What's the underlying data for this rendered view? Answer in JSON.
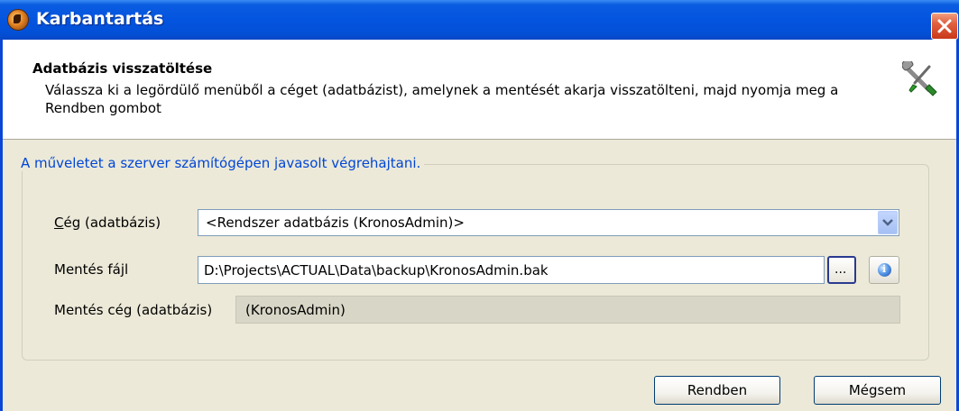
{
  "window": {
    "title": "Karbantartás"
  },
  "header": {
    "title": "Adatbázis visszatöltése",
    "description": "Válassza ki a legördülő menüből a céget (adatbázist), amelynek a mentését akarja visszatölteni, majd nyomja meg a Rendben gombot"
  },
  "group": {
    "caption": "A műveletet a szerver számítógépen javasolt végrehajtani."
  },
  "fields": {
    "company_label_underlined": "C",
    "company_label_rest": "ég (adatbázis)",
    "company_value": "<Rendszer adatbázis (KronosAdmin)>",
    "backup_file_label": "Mentés fájl",
    "backup_file_value": "D:\\Projects\\ACTUAL\\Data\\backup\\KronosAdmin.bak",
    "browse_label": "...",
    "backup_company_label": "Mentés cég (adatbázis)",
    "backup_company_value": "(KronosAdmin)"
  },
  "buttons": {
    "ok": "Rendben",
    "cancel": "Mégsem"
  },
  "icons": {
    "app": "app-icon",
    "close": "close-icon",
    "tools": "wrench-screwdriver-icon",
    "dropdown": "chevron-down-icon",
    "info": "info-icon"
  }
}
